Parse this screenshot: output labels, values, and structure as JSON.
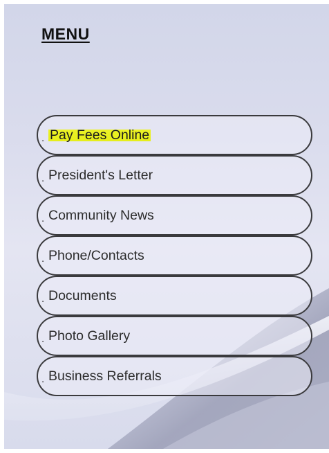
{
  "menu": {
    "title": "MENU",
    "items": [
      {
        "prefix": ".",
        "label": "Pay Fees Online",
        "highlighted": true
      },
      {
        "prefix": ".",
        "label": "President's Letter"
      },
      {
        "prefix": ".",
        "label": "Community News"
      },
      {
        "prefix": ".",
        "label": "Phone/Contacts"
      },
      {
        "prefix": ".",
        "label": "Documents"
      },
      {
        "prefix": ".",
        "label": "Photo Gallery"
      },
      {
        "prefix": ".",
        "label": "Business Referrals"
      }
    ]
  },
  "colors": {
    "panel_background": "#dadced",
    "button_border": "#3a3a3d",
    "highlight": "#e6ee1a",
    "swoosh": "#8e91a8"
  }
}
